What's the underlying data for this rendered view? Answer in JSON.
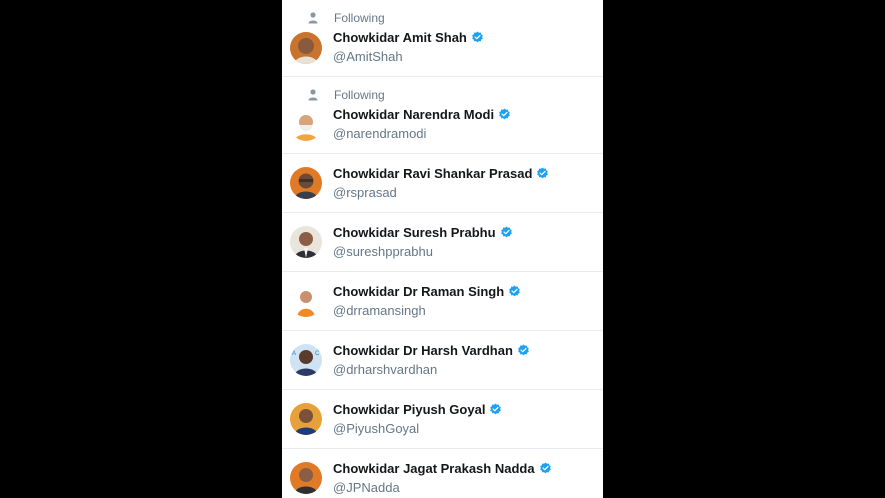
{
  "following_label": "Following",
  "colors": {
    "verified": "#1da1f2",
    "secondary_text": "#657786",
    "name_text": "#14171a",
    "divider": "#e6ecf0"
  },
  "accounts": [
    {
      "name": "Chowkidar Amit Shah",
      "handle": "@AmitShah",
      "following": true
    },
    {
      "name": "Chowkidar Narendra Modi",
      "handle": "@narendramodi",
      "following": true
    },
    {
      "name": "Chowkidar Ravi Shankar Prasad",
      "handle": "@rsprasad",
      "following": false
    },
    {
      "name": "Chowkidar Suresh Prabhu",
      "handle": "@sureshpprabhu",
      "following": false
    },
    {
      "name": "Chowkidar Dr Raman Singh",
      "handle": "@drramansingh",
      "following": false
    },
    {
      "name": "Chowkidar Dr Harsh Vardhan",
      "handle": "@drharshvardhan",
      "following": false
    },
    {
      "name": "Chowkidar Piyush Goyal",
      "handle": "@PiyushGoyal",
      "following": false
    },
    {
      "name": "Chowkidar Jagat Prakash Nadda",
      "handle": "@JPNadda",
      "following": false
    }
  ]
}
